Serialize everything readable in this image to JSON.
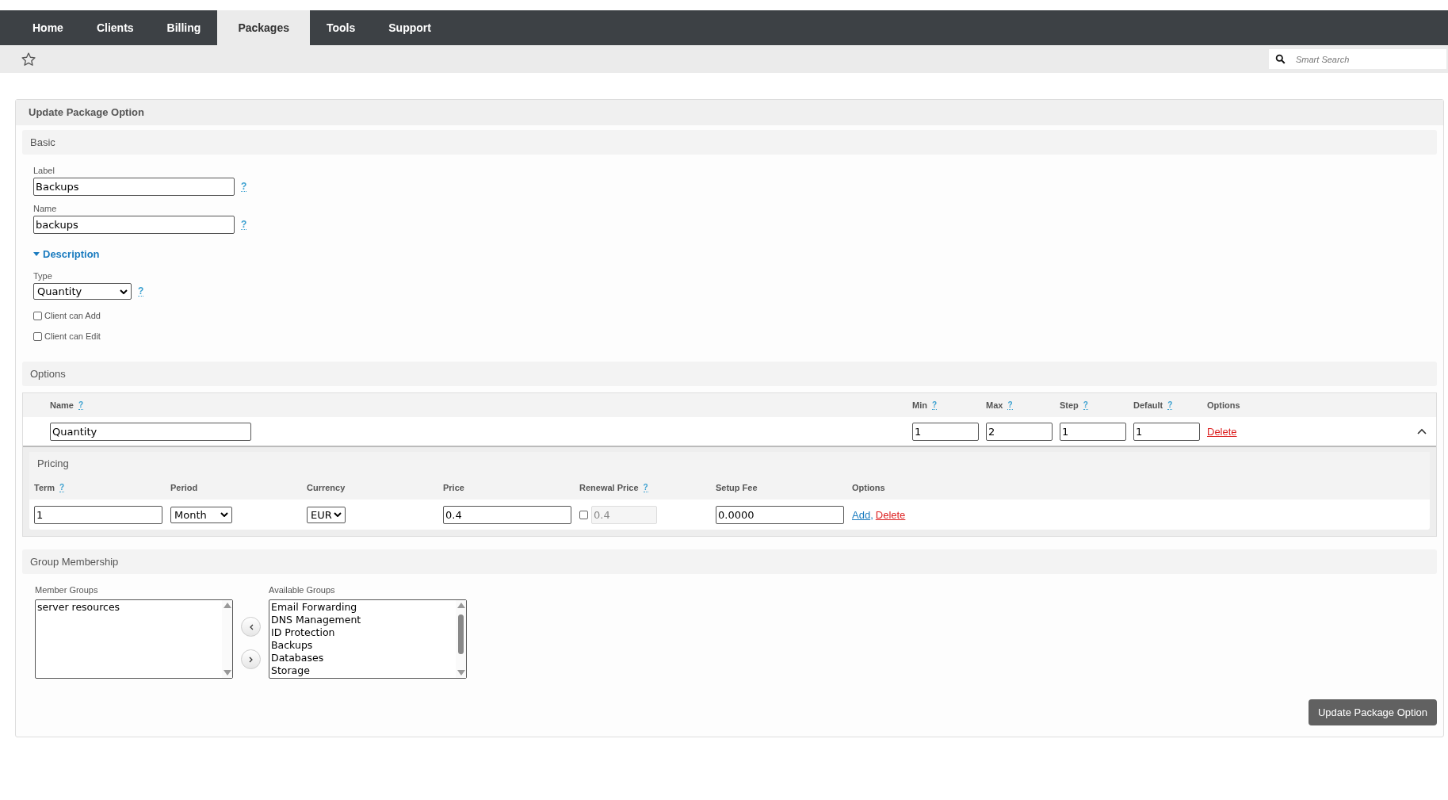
{
  "nav": {
    "tabs": [
      {
        "label": "Home",
        "selected": false
      },
      {
        "label": "Clients",
        "selected": false
      },
      {
        "label": "Billing",
        "selected": false
      },
      {
        "label": "Packages",
        "selected": true
      },
      {
        "label": "Tools",
        "selected": false
      },
      {
        "label": "Support",
        "selected": false
      }
    ]
  },
  "search": {
    "placeholder": "Smart Search"
  },
  "panel": {
    "title": "Update Package Option",
    "basic": {
      "title": "Basic",
      "fields": [
        {
          "label": "Label",
          "value": "Backups",
          "help": "?"
        },
        {
          "label": "Name",
          "value": "backups",
          "help": "?"
        }
      ],
      "description_toggle": {
        "label": "Description",
        "expanded": true
      },
      "type": {
        "label": "Type",
        "value": "Quantity",
        "help": "?"
      },
      "checkboxes": [
        {
          "label": "Client can Add",
          "checked": false
        },
        {
          "label": "Client can Edit",
          "checked": false
        }
      ]
    },
    "options": {
      "title": "Options",
      "columns": [
        {
          "label": "Name",
          "help": "?"
        },
        {
          "label": "Min",
          "help": "?"
        },
        {
          "label": "Max",
          "help": "?"
        },
        {
          "label": "Step",
          "help": "?"
        },
        {
          "label": "Default",
          "help": "?"
        },
        {
          "label": "Options"
        }
      ],
      "rows": [
        {
          "name": "Quantity",
          "min": "1",
          "max": "2",
          "step": "1",
          "default": "1",
          "action": "Delete",
          "expanded": true,
          "pricing": {
            "title": "Pricing",
            "columns": [
              {
                "label": "Term",
                "help": "?"
              },
              {
                "label": "Period"
              },
              {
                "label": "Currency"
              },
              {
                "label": "Price"
              },
              {
                "label": "Renewal Price",
                "help": "?"
              },
              {
                "label": "Setup Fee"
              },
              {
                "label": "Options"
              }
            ],
            "rows": [
              {
                "term": "1",
                "period": "Month",
                "currency": "EUR",
                "price": "0.4",
                "renewal_enabled": false,
                "renewal_price": "0.4",
                "setup_fee": "0.0000",
                "actions": [
                  {
                    "label": "Add",
                    "kind": "add"
                  },
                  {
                    "label": "Delete",
                    "kind": "delete"
                  }
                ],
                "separator": ","
              }
            ]
          }
        }
      ]
    },
    "groups": {
      "title": "Group Membership",
      "member_label": "Member Groups",
      "member_items": [
        "server resources"
      ],
      "available_label": "Available Groups",
      "available_items": [
        "Email Forwarding",
        "DNS Management",
        "ID Protection",
        "Backups",
        "Databases",
        "Storage"
      ]
    },
    "submit": "Update Package Option"
  }
}
